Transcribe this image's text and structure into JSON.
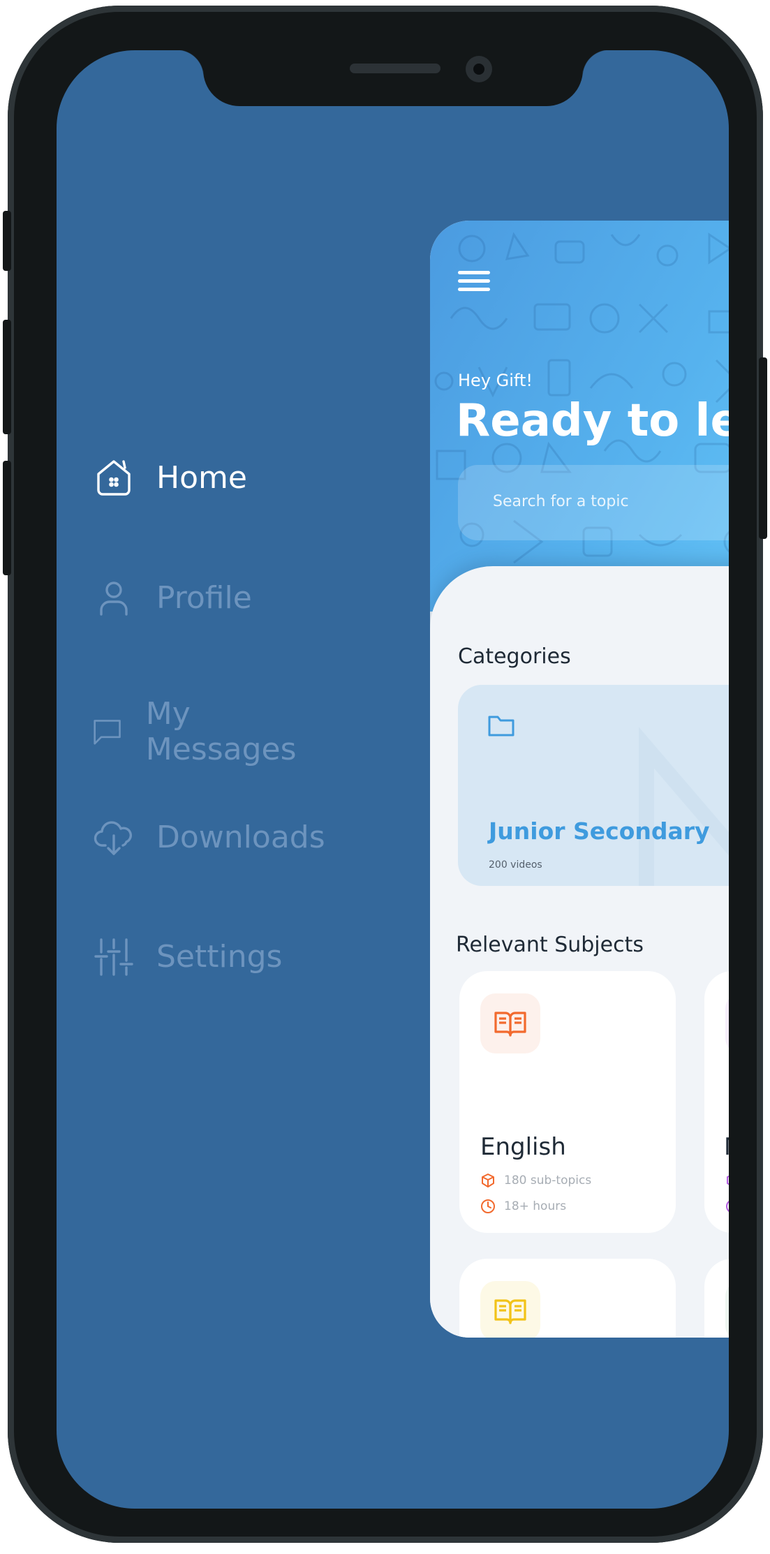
{
  "menu": {
    "items": [
      {
        "label": "Home",
        "icon": "home-icon",
        "active": true
      },
      {
        "label": "Profile",
        "icon": "user-icon",
        "active": false
      },
      {
        "label": "My Messages",
        "icon": "message-icon",
        "active": false
      },
      {
        "label": "Downloads",
        "icon": "cloud-download-icon",
        "active": false
      },
      {
        "label": "Settings",
        "icon": "sliders-icon",
        "active": false
      }
    ]
  },
  "header": {
    "greeting": "Hey Gift!",
    "headline": "Ready to lear",
    "search_placeholder": "Search for a topic"
  },
  "categories": {
    "title": "Categories",
    "items": [
      {
        "name": "Junior Secondary",
        "count": "200 videos",
        "icon": "folder-icon"
      }
    ]
  },
  "subjects": {
    "title": "Relevant Subjects",
    "items": [
      {
        "name": "English",
        "subtopics": "180 sub-topics",
        "hours": "18+ hours",
        "icon": "book-icon",
        "color": "#f26a2e"
      },
      {
        "name": "M",
        "subtopics": "",
        "hours": "",
        "icon": "book-icon",
        "color": "#b25ae0"
      },
      {
        "name": "",
        "subtopics": "",
        "hours": "",
        "icon": "book-icon",
        "color": "#f2c319"
      }
    ]
  },
  "colors": {
    "drawer_bg": "#34689b",
    "hero_blue": "#56b2ee",
    "accent": "#3f9bde"
  }
}
